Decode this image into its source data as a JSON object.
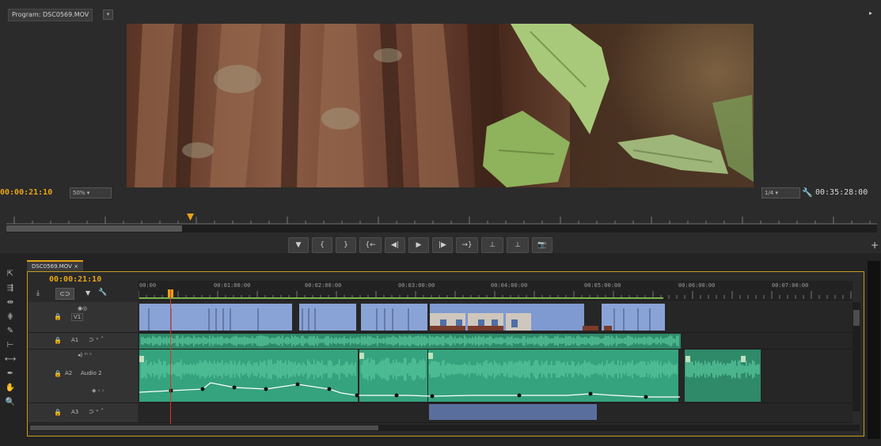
{
  "monitor": {
    "tab_label": "Program: DSC0569.MOV",
    "timecode_current": "00:00:21:10",
    "zoom_level": "50%",
    "quality": "1/4",
    "timecode_duration": "00:35:28:00"
  },
  "transport": {
    "buttons": [
      {
        "name": "add-marker-button",
        "glyph": "▼"
      },
      {
        "name": "mark-in-button",
        "glyph": "{"
      },
      {
        "name": "mark-out-button",
        "glyph": "}"
      },
      {
        "name": "go-to-in-button",
        "glyph": "{←"
      },
      {
        "name": "step-back-button",
        "glyph": "◀|"
      },
      {
        "name": "play-button",
        "glyph": "▶"
      },
      {
        "name": "step-forward-button",
        "glyph": "|▶"
      },
      {
        "name": "go-to-out-button",
        "glyph": "→}"
      },
      {
        "name": "lift-button",
        "glyph": "⊥"
      },
      {
        "name": "extract-button",
        "glyph": "⊥"
      },
      {
        "name": "export-frame-button",
        "glyph": "📷"
      }
    ],
    "add_button": "+"
  },
  "timeline": {
    "sequence_tab": "DSC0569.MOV",
    "timecode": "00:00:21:10",
    "ruler_labels": [
      "00:00",
      "00:01:00:00",
      "00:02:00:00",
      "00:03:00:00",
      "00:04:00:00",
      "00:05:00:00",
      "00:06:00:00",
      "00:07:00:00"
    ],
    "tracks": {
      "v1": "V1",
      "a1": "A1",
      "a2": "A2",
      "a2_name": "Audio 2",
      "a3": "A3"
    }
  },
  "colors": {
    "accent": "#e8a416",
    "video_clip": "#8aa3d6",
    "audio_clip": "#35a37e",
    "playhead": "#e0322b"
  }
}
